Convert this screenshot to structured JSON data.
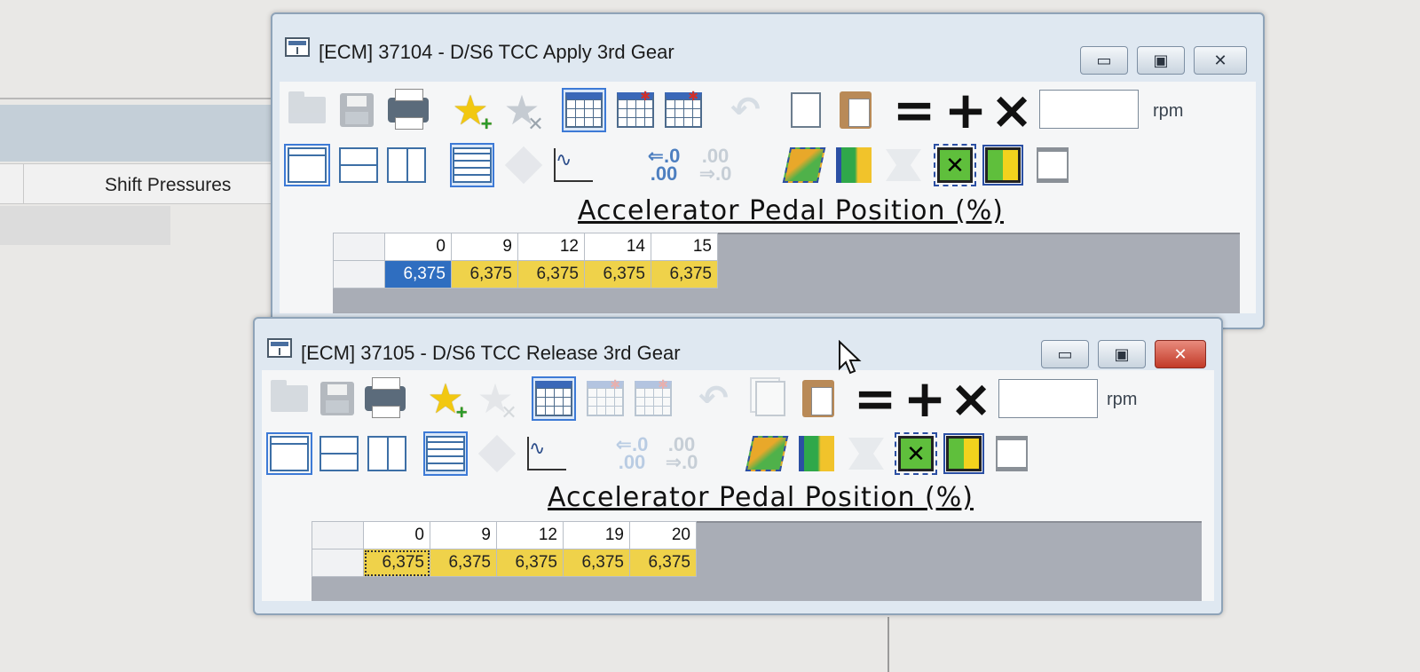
{
  "background": {
    "tab_label": "Shift Pressures"
  },
  "windows": [
    {
      "title": "[ECM] 37104 - D/S6 TCC Apply 3rd Gear",
      "input_value": "",
      "unit": "rpm",
      "axis_title": "Accelerator Pedal Position (%)",
      "columns": [
        "0",
        "9",
        "12",
        "14",
        "15"
      ],
      "row_values": [
        "6,375",
        "6,375",
        "6,375",
        "6,375",
        "6,375"
      ],
      "selected_index": 0
    },
    {
      "title": "[ECM] 37105 - D/S6 TCC Release 3rd Gear",
      "input_value": "",
      "unit": "rpm",
      "axis_title": "Accelerator Pedal Position (%)",
      "columns": [
        "0",
        "9",
        "12",
        "19",
        "20"
      ],
      "row_values": [
        "6,375",
        "6,375",
        "6,375",
        "6,375",
        "6,375"
      ],
      "focused_index": 0
    }
  ],
  "toolbar_ops": {
    "equals": "=",
    "plus": "+",
    "times": "×"
  },
  "window_buttons": {
    "minimize": "▭",
    "maximize": "▣",
    "close": "✕"
  },
  "icons": {
    "decimal_more_top": "⇐.0",
    "decimal_more_bottom": ".00",
    "decimal_less_top": ".00",
    "decimal_less_bottom": "⇒.0"
  },
  "colors": {
    "cell_fill": "#efd24a",
    "cell_selected": "#2f6ec0",
    "accent": "#3d7ad6"
  }
}
